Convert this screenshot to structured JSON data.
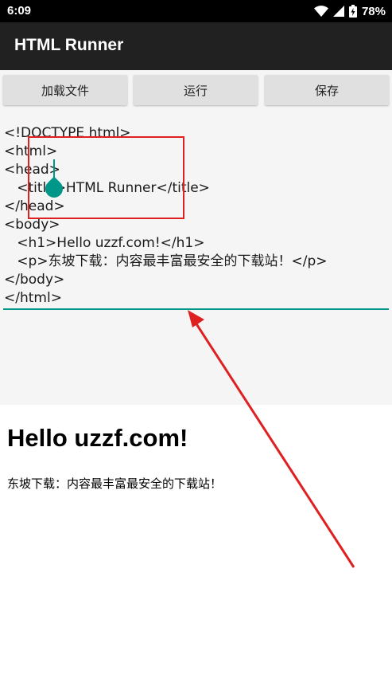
{
  "status_bar": {
    "time": "6:09",
    "battery": "78%",
    "icons": [
      "wifi-icon",
      "signal-icon",
      "battery-icon"
    ]
  },
  "app_bar": {
    "title": "HTML Runner"
  },
  "toolbar": {
    "load_label": "加载文件",
    "run_label": "运行",
    "save_label": "保存"
  },
  "editor": {
    "lines": [
      "<!DOCTYPE html>",
      "<html>",
      "<head>",
      "   <title>HTML Runner</title>",
      "</head>",
      "<body>",
      "   <h1>Hello uzzf.com!</h1>",
      "   <p>东坡下载：内容最丰富最安全的下载站！</p>",
      "</body>",
      "</html>"
    ],
    "accent_color": "#009688"
  },
  "preview": {
    "heading": "Hello uzzf.com!",
    "paragraph": "东坡下载：内容最丰富最安全的下载站！"
  },
  "annotation": {
    "color": "#e02020"
  }
}
